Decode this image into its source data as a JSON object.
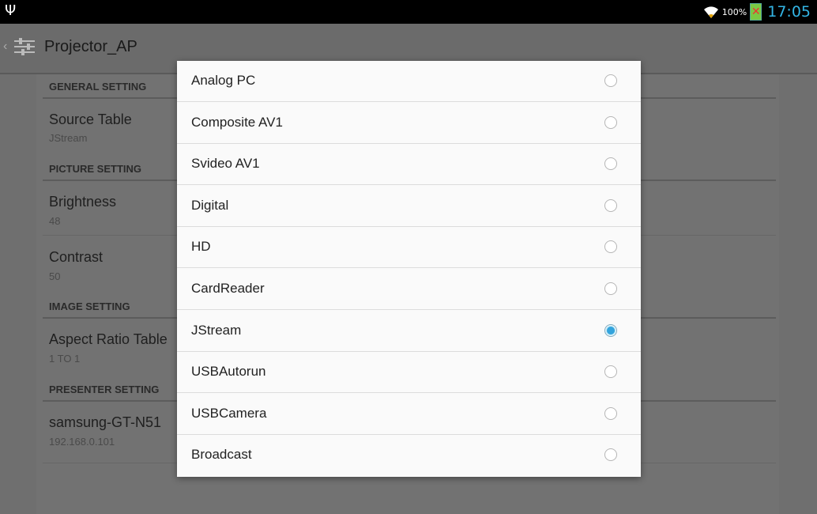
{
  "status_bar": {
    "usb_icon": "usb-icon",
    "wifi_icon": "wifi-icon",
    "battery_percent": "100%",
    "battery_icon": "battery-charging-error-icon",
    "time": "17:05"
  },
  "action_bar": {
    "up_icon": "up-caret-icon",
    "app_icon": "sliders-icon",
    "title": "Projector_AP"
  },
  "settings": {
    "general_header": "GENERAL SETTING",
    "source_table": {
      "title": "Source Table",
      "value": "JStream"
    },
    "picture_header": "PICTURE SETTING",
    "brightness": {
      "title": "Brightness",
      "value": "48"
    },
    "contrast": {
      "title": "Contrast",
      "value": "50"
    },
    "image_header": "IMAGE SETTING",
    "aspect_ratio": {
      "title": "Aspect Ratio Table",
      "value": "1 TO 1"
    },
    "presenter_header": "PRESENTER SETTING",
    "presenter_device": {
      "title": "samsung-GT-N51",
      "value": "192.168.0.101"
    }
  },
  "dialog": {
    "options": [
      {
        "label": "Analog PC",
        "selected": false
      },
      {
        "label": "Composite AV1",
        "selected": false
      },
      {
        "label": "Svideo AV1",
        "selected": false
      },
      {
        "label": "Digital",
        "selected": false
      },
      {
        "label": "HD",
        "selected": false
      },
      {
        "label": "CardReader",
        "selected": false
      },
      {
        "label": "JStream",
        "selected": true
      },
      {
        "label": "USBAutorun",
        "selected": false
      },
      {
        "label": "USBCamera",
        "selected": false
      },
      {
        "label": "Broadcast",
        "selected": false
      }
    ]
  },
  "colors": {
    "accent": "#33b5e5",
    "dim_background": "#6f6f6f"
  }
}
